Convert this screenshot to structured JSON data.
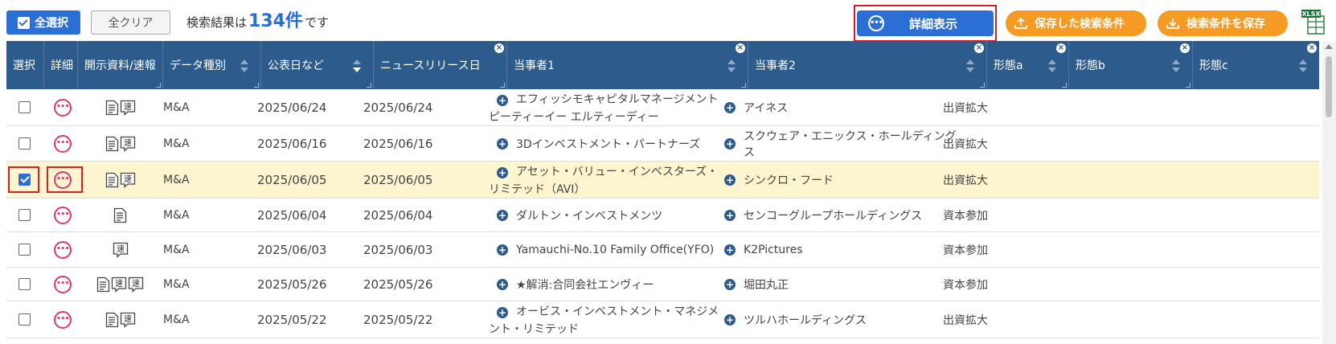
{
  "toolbar": {
    "select_all_label": "全選択",
    "clear_all_label": "全クリア",
    "result_prefix": "検索結果は",
    "result_count": "134件",
    "result_suffix": "です",
    "detail_label": "詳細表示",
    "saved_conditions_label": "保存した検索条件",
    "save_conditions_label": "検索条件を保存",
    "export_label": "XLSX"
  },
  "columns": [
    {
      "label": "選択"
    },
    {
      "label": "詳細"
    },
    {
      "label": "開示資料/速報"
    },
    {
      "label": "データ種別"
    },
    {
      "label": "公表日など"
    },
    {
      "label": "ニュースリリース日"
    },
    {
      "label": "当事者1"
    },
    {
      "label": "当事者2"
    },
    {
      "label": "形態a"
    },
    {
      "label": "形態b"
    },
    {
      "label": "形態c"
    }
  ],
  "doc_badge_label": "速",
  "rows": [
    {
      "checked": false,
      "docs": [
        "doc",
        "speed"
      ],
      "type": "M&A",
      "announce": "2025/06/24",
      "release": "2025/06/24",
      "party1": "エフィッシモキャピタルマネージメント ピーティーイー エルティーディー",
      "party2": "アイネス",
      "form_a": "出資拡大"
    },
    {
      "checked": false,
      "docs": [
        "doc",
        "speed"
      ],
      "type": "M&A",
      "announce": "2025/06/16",
      "release": "2025/06/16",
      "party1": "3Dインベストメント・パートナーズ",
      "party2": "スクウェア・エニックス・ホールディングス",
      "form_a": "出資拡大"
    },
    {
      "checked": true,
      "docs": [
        "doc",
        "speed"
      ],
      "type": "M&A",
      "announce": "2025/06/05",
      "release": "2025/06/05",
      "party1": "アセット・バリュー・インベスターズ・リミテッド（AVI）",
      "party2": "シンクロ・フード",
      "form_a": "出資拡大"
    },
    {
      "checked": false,
      "docs": [
        "doc"
      ],
      "type": "M&A",
      "announce": "2025/06/04",
      "release": "2025/06/04",
      "party1": "ダルトン・インベストメンツ",
      "party2": "センコーグループホールディングス",
      "form_a": "資本参加"
    },
    {
      "checked": false,
      "docs": [
        "speed"
      ],
      "type": "M&A",
      "announce": "2025/06/03",
      "release": "2025/06/03",
      "party1": "Yamauchi-No.10 Family Office(YFO)",
      "party2": "K2Pictures",
      "form_a": "資本参加"
    },
    {
      "checked": false,
      "docs": [
        "doc",
        "speed",
        "speed"
      ],
      "type": "M&A",
      "announce": "2025/05/26",
      "release": "2025/05/26",
      "party1": "★解消:合同会社エンヴィー",
      "party2": "堀田丸正",
      "form_a": "資本参加"
    },
    {
      "checked": false,
      "docs": [
        "doc",
        "speed"
      ],
      "type": "M&A",
      "announce": "2025/05/22",
      "release": "2025/05/22",
      "party1": "オービス・インベストメント・マネジメント・リミテッド",
      "party2": "ツルハホールディングス",
      "form_a": "出資拡大"
    }
  ],
  "colors": {
    "header_bg": "#2d5b8c",
    "primary_blue": "#2c6fd4",
    "orange": "#f59a22",
    "highlight_red": "#d0202a",
    "selected_row": "#fdf5cf",
    "detail_pink": "#d63a6f"
  }
}
